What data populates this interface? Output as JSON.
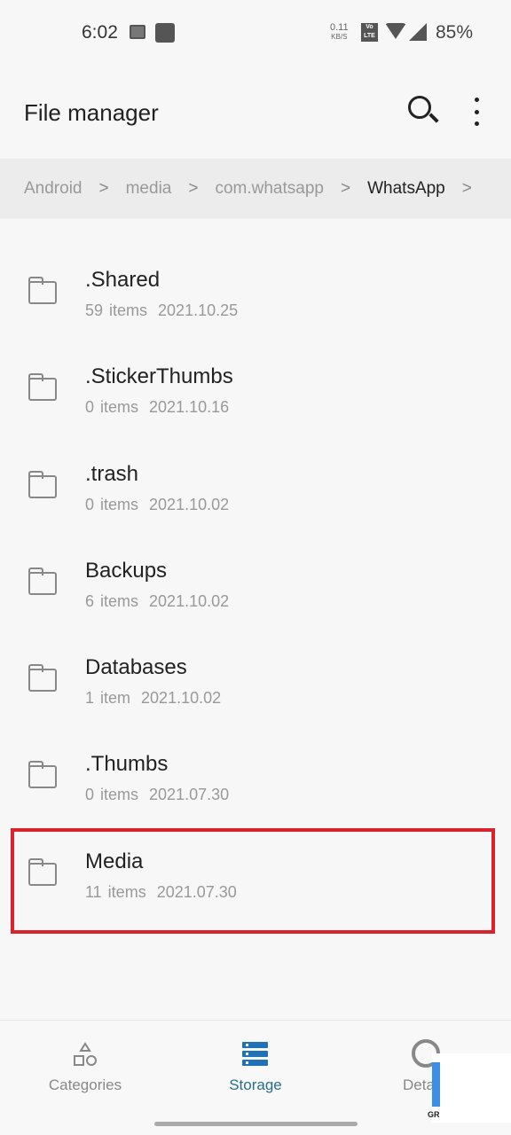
{
  "status_bar": {
    "time": "6:02",
    "net_speed": "0.11",
    "net_unit": "KB/S",
    "volte": "Vo LTE",
    "battery": "85%"
  },
  "header": {
    "title": "File manager",
    "search_icon": "search-icon",
    "more_icon": "more-vert-icon"
  },
  "breadcrumb": [
    "Android",
    "media",
    "com.whatsapp",
    "WhatsApp"
  ],
  "folders": [
    {
      "name": ".Shared",
      "count": "59 items",
      "date": "2021.10.25"
    },
    {
      "name": ".StickerThumbs",
      "count": "0 items",
      "date": "2021.10.16"
    },
    {
      "name": ".trash",
      "count": "0 items",
      "date": "2021.10.02"
    },
    {
      "name": "Backups",
      "count": "6 items",
      "date": "2021.10.02"
    },
    {
      "name": "Databases",
      "count": "1 item",
      "date": "2021.10.02"
    },
    {
      "name": ".Thumbs",
      "count": "0 items",
      "date": "2021.07.30"
    },
    {
      "name": "Media",
      "count": "11 items",
      "date": "2021.07.30",
      "highlighted": true
    }
  ],
  "bottom_nav": [
    {
      "label": "Categories",
      "icon": "shapes-icon"
    },
    {
      "label": "Storage",
      "icon": "storage-icon",
      "active": true
    },
    {
      "label": "Details",
      "icon": "pie-icon"
    }
  ],
  "watermark": "GR",
  "colors": {
    "highlight": "#d9232d",
    "active": "#1f72b8"
  }
}
